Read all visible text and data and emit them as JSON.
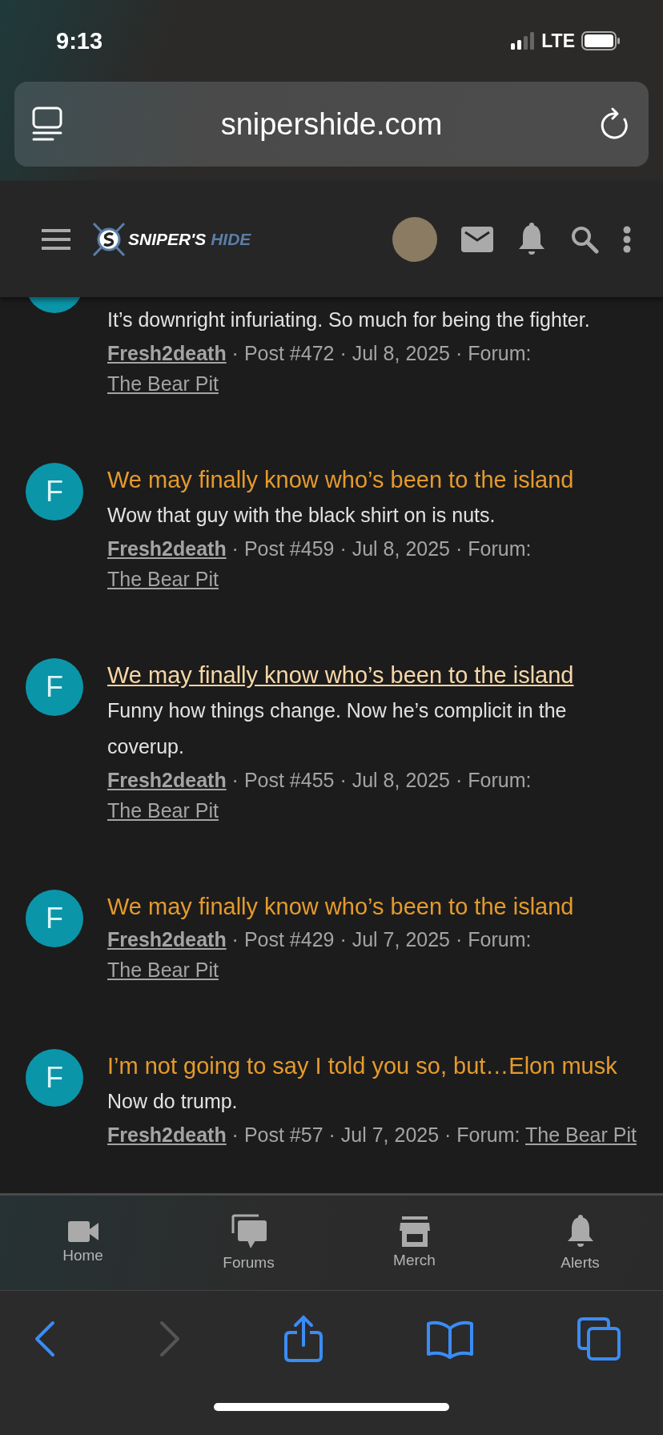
{
  "status_bar": {
    "time": "9:13",
    "network": "LTE"
  },
  "address_bar": {
    "url": "snipershide.com"
  },
  "site_header": {
    "logo_words": [
      "SNIPER'S",
      "HIDE"
    ]
  },
  "posts": [
    {
      "body": "It’s downright infuriating. So much for being the fighter.",
      "author": "Fresh2death",
      "meta": "· Post #472 · Jul 8, 2025 · Forum:",
      "forum": "The Bear Pit"
    },
    {
      "avatar_letter": "F",
      "title": "We may finally know who’s been to the island",
      "hovered": false,
      "body": "Wow that guy with the black shirt on is nuts.",
      "author": "Fresh2death",
      "meta": "· Post #459 · Jul 8, 2025 · Forum:",
      "forum": "The Bear Pit"
    },
    {
      "avatar_letter": "F",
      "title": "We may finally know who’s been to the island",
      "hovered": true,
      "body": "Funny how things change. Now he’s complicit in the coverup.",
      "author": "Fresh2death",
      "meta": "· Post #455 · Jul 8, 2025 · Forum:",
      "forum": "The Bear Pit"
    },
    {
      "avatar_letter": "F",
      "title": "We may finally know who’s been to the island",
      "hovered": false,
      "author": "Fresh2death",
      "meta": "· Post #429 · Jul 7, 2025 · Forum:",
      "forum": "The Bear Pit"
    },
    {
      "avatar_letter": "F",
      "title": "I’m not going to say I told you so, but…Elon musk",
      "hovered": false,
      "body": "Now do trump.",
      "author": "Fresh2death",
      "meta": "· Post #57 · Jul 7, 2025 · Forum:",
      "forum": "The Bear Pit"
    }
  ],
  "bottom_nav": [
    {
      "kind": "video",
      "label": "Home"
    },
    {
      "kind": "chat",
      "label": "Forums"
    },
    {
      "kind": "store",
      "label": "Merch"
    },
    {
      "kind": "bell",
      "label": "Alerts"
    }
  ],
  "browser_toolbar": {
    "back_enabled": true,
    "forward_enabled": false
  }
}
